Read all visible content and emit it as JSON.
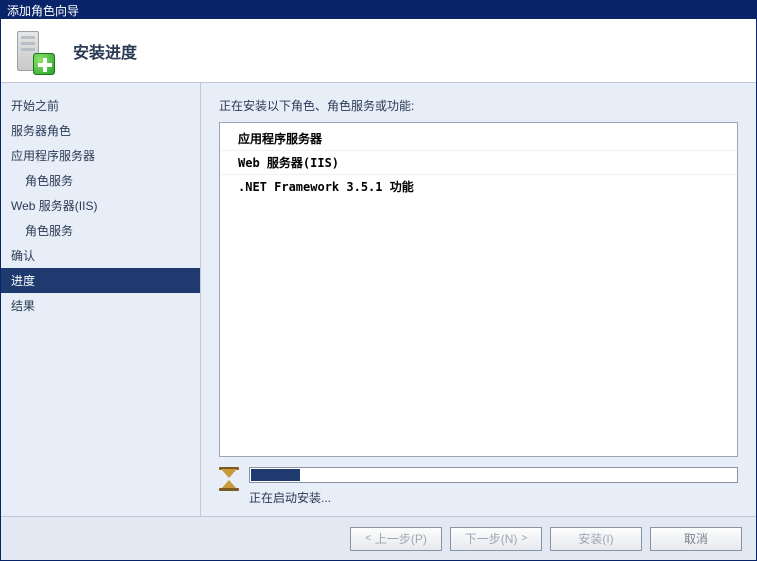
{
  "window": {
    "title": "添加角色向导"
  },
  "header": {
    "title": "安装进度"
  },
  "sidebar": {
    "items": [
      {
        "label": "开始之前",
        "indent": 0
      },
      {
        "label": "服务器角色",
        "indent": 0
      },
      {
        "label": "应用程序服务器",
        "indent": 0
      },
      {
        "label": "角色服务",
        "indent": 1
      },
      {
        "label": "Web 服务器(IIS)",
        "indent": 0
      },
      {
        "label": "角色服务",
        "indent": 1
      },
      {
        "label": "确认",
        "indent": 0
      },
      {
        "label": "进度",
        "indent": 0,
        "selected": true
      },
      {
        "label": "结果",
        "indent": 0
      }
    ]
  },
  "content": {
    "instruction": "正在安装以下角色、角色服务或功能:",
    "items": [
      "应用程序服务器",
      "Web 服务器(IIS)",
      ".NET Framework 3.5.1 功能"
    ],
    "progress_label": "正在启动安装..."
  },
  "footer": {
    "prev": "上一步(P)",
    "next": "下一步(N)",
    "install": "安装(I)",
    "cancel": "取消"
  }
}
